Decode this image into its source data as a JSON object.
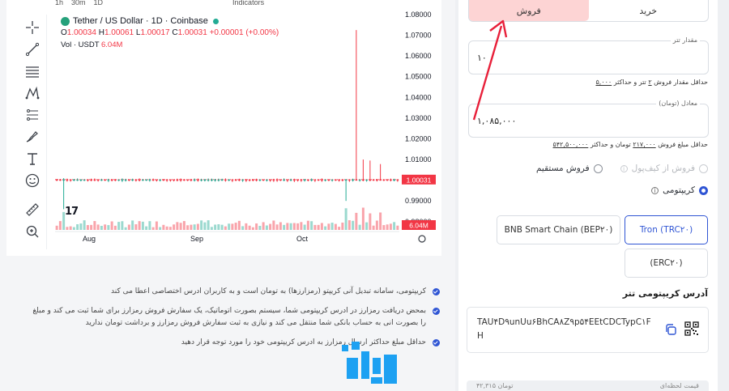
{
  "chart": {
    "topbar": [
      "1h",
      "30m",
      "1D"
    ],
    "indicators_label": "Indicators",
    "title": "Tether / US Dollar · 1D · Coinbase",
    "ohlc": {
      "o_label": "O",
      "o": "1.00034",
      "h_label": "H",
      "h": "1.00061",
      "l_label": "L",
      "l": "1.00017",
      "c_label": "C",
      "c": "1.00031",
      "change": "+0.00001 (+0.00%)"
    },
    "vol_label": "Vol · USDT",
    "vol_value": "6.04M",
    "tv_logo": "17",
    "price_badge": "1.00031",
    "vol_badge": "6.04M",
    "colors": {
      "up": "#22ab94",
      "down": "#f23645"
    }
  },
  "tools": [
    "crosshair-icon",
    "trendline-icon",
    "fib-icon",
    "pattern-icon",
    "prediction-icon",
    "brush-icon",
    "text-icon",
    "emoji-icon",
    "ruler-icon",
    "zoom-icon"
  ],
  "chart_data": {
    "type": "candlestick",
    "title": "Tether / US Dollar · 1D · Coinbase",
    "y_ticks": [
      "1.08000",
      "1.07000",
      "1.06000",
      "1.05000",
      "1.04000",
      "1.03000",
      "1.02000",
      "1.01000",
      "1.00000",
      "0.99000",
      "0.98000"
    ],
    "ylim": [
      0.976,
      1.08
    ],
    "x_ticks": [
      "Aug",
      "Sep",
      "Oct"
    ],
    "last_close": 1.00031,
    "spikes": [
      {
        "index": 2,
        "low": 0.986,
        "high": 1.001
      },
      {
        "index": 84,
        "low": 0.99,
        "high": 1.0005
      },
      {
        "index": 87,
        "low": 1.0,
        "high": 1.0725
      },
      {
        "index": 89,
        "low": 0.9995,
        "high": 1.01
      },
      {
        "index": 91,
        "low": 0.9995,
        "high": 1.0095
      },
      {
        "index": 94,
        "low": 0.9998,
        "high": 1.0078
      }
    ]
  },
  "notes": [
    "کریپتومی، سامانه تبدیل آنی کریپتو (رمزارزها) به تومان است و به کاربران ادرس اختصاصی اعطا می کند",
    "بمحض دریافت رمزارز در ادرس کریپتومی شما، سیستم بصورت اتوماتیک، یک سفارش فروش رمزارز برای شما ثبت می کند و مبلغ را بصورت انی به حساب بانکی شما منتقل می کند و نیازی به ثبت سفارش فروش رمزارز و برداشت تومان ندارید",
    "حداقل مبلغ حداکثر ارسال رمزارز به ادرس کریپتومی خود را مورد توجه قرار دهید"
  ],
  "side": {
    "tab_buy": "خرید",
    "tab_sell": "فروش",
    "amount_label": "مقدار تتر",
    "amount_value": "۱۰",
    "amount_hint_pre": "حداقل مقدار فروش",
    "amount_min": "۲",
    "amount_hint_mid": "تتر و حداکثر",
    "amount_max": "۵,۰۰۰",
    "toman_label": "معادل (تومان)",
    "toman_value": "۱,۰۸۵,۰۰۰",
    "toman_hint_pre": "حداقل مبلغ فروش",
    "toman_min": "۲۱۷,۰۰۰",
    "toman_hint_mid": "تومان و حداکثر",
    "toman_max": "۵۴۲,۵۰۰,۰۰۰",
    "opt_wallet": "فروش از کیف‌پول",
    "opt_direct": "فروش مستقیم",
    "opt_cryptomi": "کریپتومی",
    "net_bep20": "BNB Smart Chain (BEP۲۰)",
    "net_trc20": "Tron (TRC۲۰)",
    "net_erc20": "(ERC۲۰)",
    "addr_title": "آدرس کریپتومی تتر",
    "addr_value": "TAU۴D۹unUu۶BhCA۸Z۹p۵۴EEtCDCTypC۱FH",
    "bottom_left": "۴۲,۳۱۵ تومان",
    "bottom_right": "قیمت لحظه‌ای",
    "accent": "#2f55d4",
    "sell_bg": "#fdd4d4"
  }
}
